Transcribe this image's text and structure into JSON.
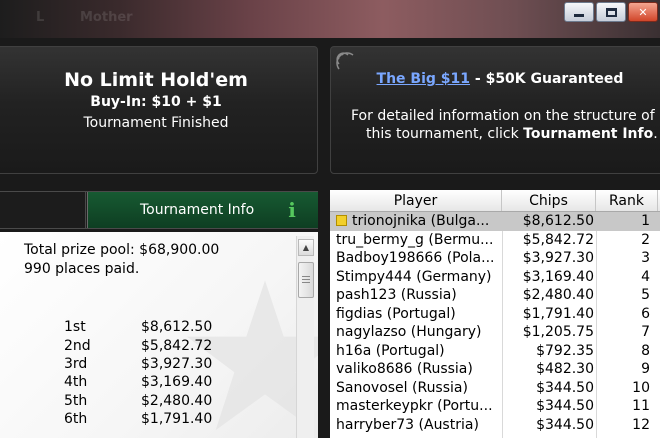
{
  "window": {
    "ghost_tabs": [
      "L",
      "Mother"
    ],
    "controls": [
      "minimize",
      "maximize",
      "close"
    ],
    "close_glyph": "✕"
  },
  "header_left": {
    "game_title": "No Limit Hold'em",
    "buy_in": "Buy-In: $10 + $1",
    "status": "Tournament Finished"
  },
  "header_right": {
    "link_text": "The Big $11",
    "link_suffix": " - $50K Guaranteed",
    "info_line1": "For detailed information on the structure of",
    "info_line2_prefix": "this tournament, click ",
    "info_line2_bold": "Tournament Info",
    "info_line2_suffix": ".",
    "icon": "signal-icon"
  },
  "tabs": {
    "info_label": "Tournament Info",
    "info_glyph": "i"
  },
  "info": {
    "prize_pool": "Total prize pool: $68,900.00",
    "places_paid": "990 places paid.",
    "payouts": [
      {
        "place": "1st",
        "amount": "$8,612.50"
      },
      {
        "place": "2nd",
        "amount": "$5,842.72"
      },
      {
        "place": "3rd",
        "amount": "$3,927.30"
      },
      {
        "place": "4th",
        "amount": "$3,169.40"
      },
      {
        "place": "5th",
        "amount": "$2,480.40"
      },
      {
        "place": "6th",
        "amount": "$1,791.40"
      }
    ]
  },
  "players": {
    "columns": [
      "Player",
      "Chips",
      "Rank"
    ],
    "rows": [
      {
        "player": "trionojnika (Bulga...",
        "chips": "$8,612.50",
        "rank": "1",
        "selected": true
      },
      {
        "player": "tru_bermy_g (Bermu...",
        "chips": "$5,842.72",
        "rank": "2"
      },
      {
        "player": "Badboy198666 (Pola...",
        "chips": "$3,927.30",
        "rank": "3"
      },
      {
        "player": "Stimpy444 (Germany)",
        "chips": "$3,169.40",
        "rank": "4"
      },
      {
        "player": "pash123 (Russia)",
        "chips": "$2,480.40",
        "rank": "5"
      },
      {
        "player": "figdias (Portugal)",
        "chips": "$1,791.40",
        "rank": "6"
      },
      {
        "player": "nagylazso (Hungary)",
        "chips": "$1,205.75",
        "rank": "7"
      },
      {
        "player": "h16a (Portugal)",
        "chips": "$792.35",
        "rank": "8"
      },
      {
        "player": "valiko8686 (Russia)",
        "chips": "$482.30",
        "rank": "9"
      },
      {
        "player": "Sanovosel (Russia)",
        "chips": "$344.50",
        "rank": "10"
      },
      {
        "player": "masterkeypkr (Portu...",
        "chips": "$344.50",
        "rank": "11"
      },
      {
        "player": "harryber73 (Austria)",
        "chips": "$344.50",
        "rank": "12"
      }
    ]
  },
  "colors": {
    "tab_active": "#175a32",
    "link": "#7aa7ff",
    "selected_row": "#c8c8c8",
    "flag": "#f2cf2a"
  }
}
